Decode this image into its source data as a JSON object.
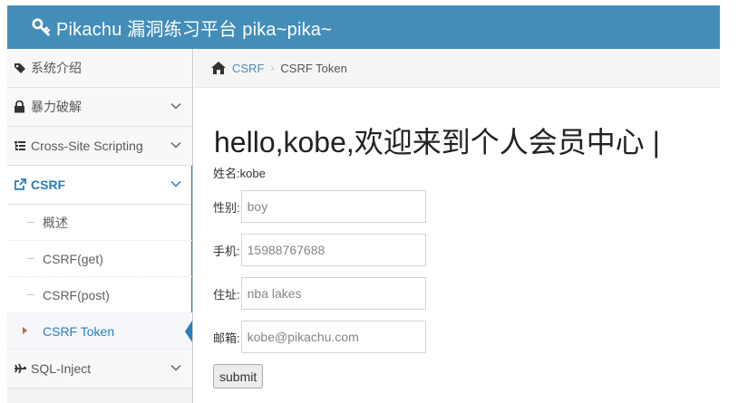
{
  "navbar": {
    "title": "Pikachu 漏洞练习平台 pika~pika~"
  },
  "sidebar": {
    "items": [
      {
        "label": "系统介绍"
      },
      {
        "label": "暴力破解"
      },
      {
        "label": "Cross-Site Scripting"
      },
      {
        "label": "CSRF"
      },
      {
        "label": "SQL-Inject"
      }
    ],
    "csrf_sub": [
      {
        "label": "概述"
      },
      {
        "label": "CSRF(get)"
      },
      {
        "label": "CSRF(post)"
      },
      {
        "label": "CSRF Token"
      }
    ]
  },
  "breadcrumb": {
    "parent": "CSRF",
    "separator": "›",
    "current": "CSRF Token"
  },
  "main": {
    "welcome": "hello,kobe,欢迎来到个人会员中心 |",
    "name_label": "姓名:",
    "name_value": "kobe",
    "fields": [
      {
        "label": "性别:",
        "value": "boy"
      },
      {
        "label": "手机:",
        "value": "15988767688"
      },
      {
        "label": "住址:",
        "value": "nba lakes"
      },
      {
        "label": "邮箱:",
        "value": "kobe@pikachu.com"
      }
    ],
    "submit_label": "submit"
  },
  "colors": {
    "navbar": "#438eb9",
    "accent": "#2b7dbc",
    "link": "#4c8fbd",
    "caret": "#c86139"
  }
}
